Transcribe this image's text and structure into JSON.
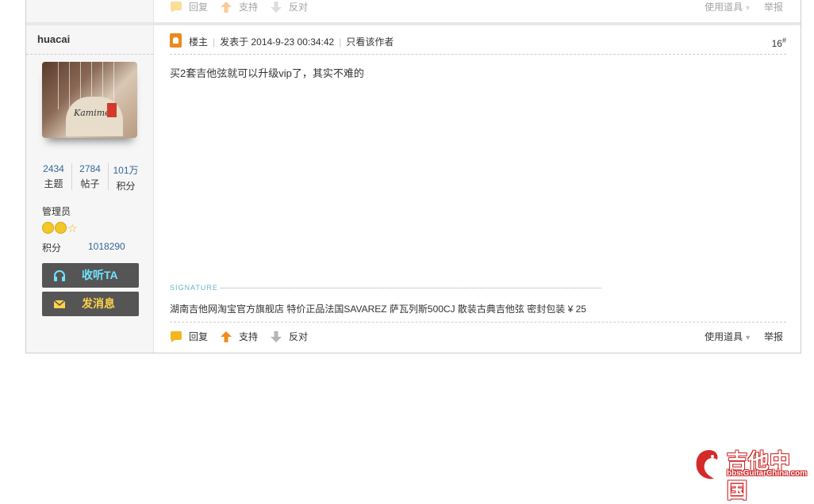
{
  "prev_post": {
    "actions": {
      "reply": "回复",
      "support": "支持",
      "oppose": "反对",
      "tools": "使用道具",
      "report": "举报"
    }
  },
  "author": {
    "username": "huacai",
    "stats": [
      {
        "value": "2434",
        "label": "主题"
      },
      {
        "value": "2784",
        "label": "帖子"
      },
      {
        "value": "101万",
        "label": "积分"
      }
    ],
    "group": "管理员",
    "credits_label": "积分",
    "credits_value": "1018290",
    "listen_button": "收听TA",
    "message_button": "发消息",
    "avatar_brand": "Kamime"
  },
  "post": {
    "owner_label": "楼主",
    "posted_at": "发表于 2014-9-23 00:34:42",
    "only_author": "只看该作者",
    "floor_number": "16",
    "floor_mark": "#",
    "content": "买2套吉他弦就可以升级vip了，其实不难的",
    "signature_label": "SIGNATURE",
    "signature_text": "湖南吉他网淘宝官方旗舰店 特价正品法国SAVAREZ 萨瓦列斯500CJ 散装古典吉他弦 密封包装 ¥ 25",
    "actions": {
      "reply": "回复",
      "support": "支持",
      "oppose": "反对",
      "tools": "使用道具",
      "report": "举报"
    }
  },
  "watermark": {
    "title": "吉他中国",
    "subtitle": "bbs.GuitarChina.com"
  },
  "colors": {
    "accent_blue": "#336699",
    "button_bg": "#555555",
    "button_text": "#ffd24a",
    "owner_icon": "#e98b20"
  }
}
